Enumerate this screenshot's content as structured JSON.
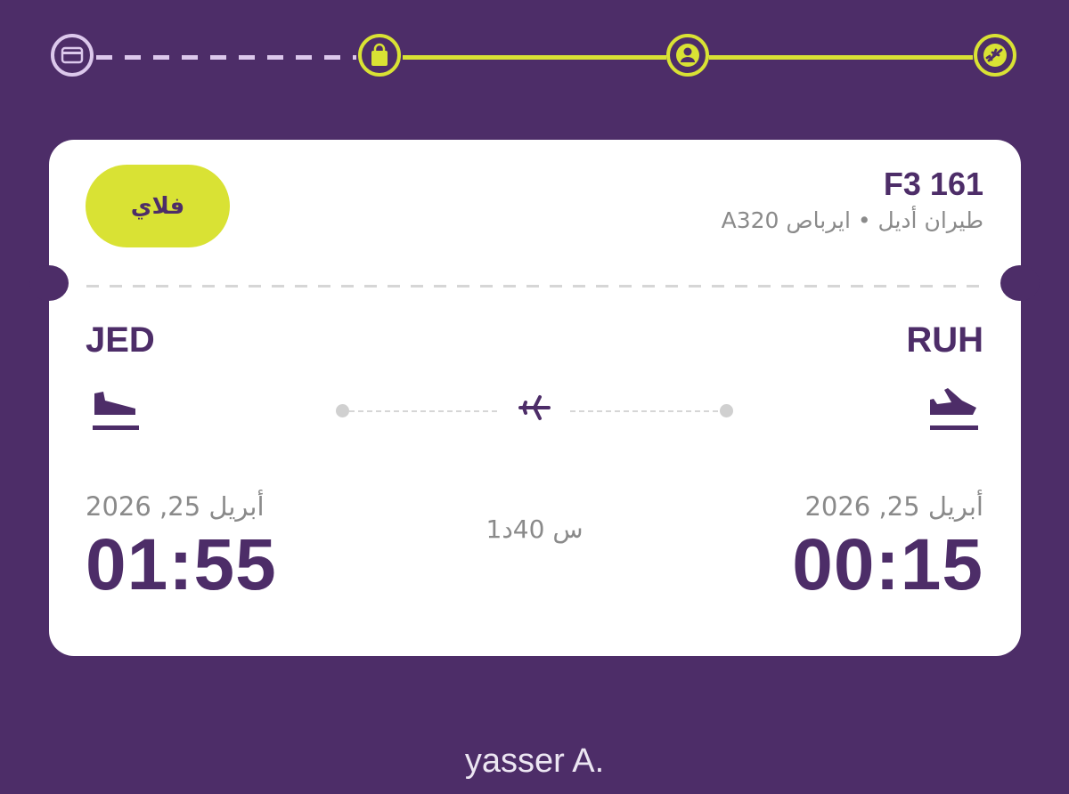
{
  "stepper": {
    "steps": [
      {
        "icon": "card-icon",
        "state": "pending"
      },
      {
        "icon": "bag-icon",
        "state": "done"
      },
      {
        "icon": "person-icon",
        "state": "done"
      },
      {
        "icon": "plane-icon",
        "state": "done"
      }
    ],
    "colors": {
      "done": "#d9e234",
      "pending": "#dcc8ec"
    }
  },
  "ticket": {
    "badge": "فلاي",
    "flight_number": "F3 161",
    "aircraft": "طيران أديل • ايرباص A320",
    "origin": {
      "code": "RUH",
      "date": "أبريل 25, 2026",
      "time": "00:15",
      "icon": "departure-icon"
    },
    "destination": {
      "code": "JED",
      "date": "أبريل 25, 2026",
      "time": "01:55",
      "icon": "arrival-icon"
    },
    "duration": "1س 40د"
  },
  "footer": {
    "username": "yasser A."
  },
  "colors": {
    "background": "#4d2d68",
    "accent": "#d9e234",
    "primary_text": "#4d2d68",
    "secondary_text": "#8a8a8a"
  }
}
